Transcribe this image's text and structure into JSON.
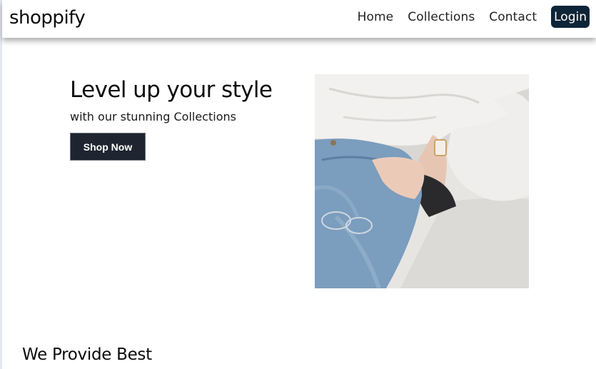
{
  "navbar": {
    "brand": "shoppify",
    "links": [
      "Home",
      "Collections",
      "Contact"
    ],
    "login_label": "Login"
  },
  "hero": {
    "title": "Level up your style",
    "subtitle": "with our stunning Collections",
    "cta_label": "Shop Now"
  },
  "features": {
    "title": "We Provide Best"
  },
  "colors": {
    "login_bg": "#0e2537",
    "cta_bg": "#1f2530"
  }
}
